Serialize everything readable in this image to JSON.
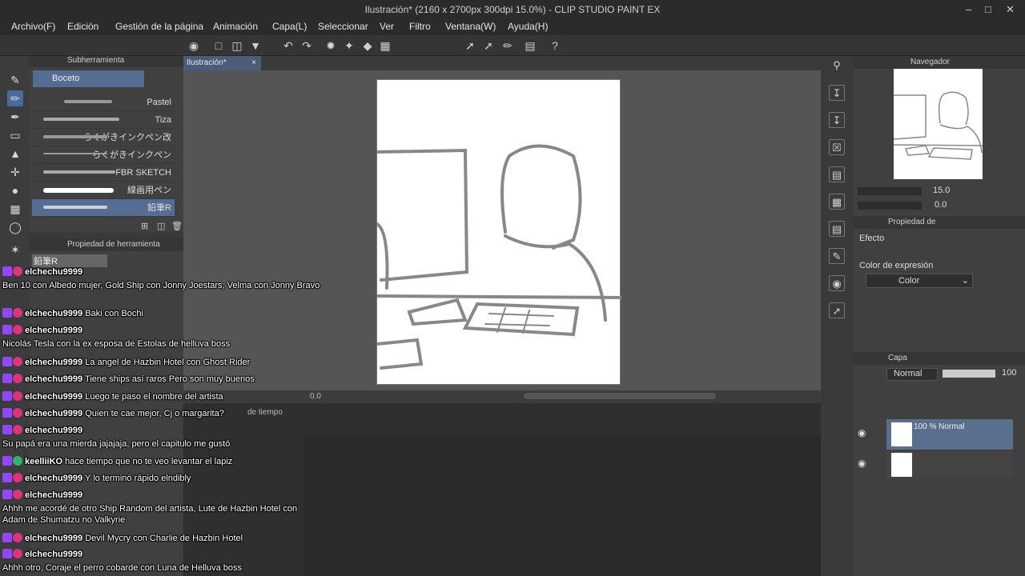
{
  "window": {
    "title": "Ilustración* (2160 x 2700px 300dpi 15.0%) - CLIP STUDIO PAINT EX"
  },
  "menu": [
    "Archivo(F)",
    "Edición",
    "Gestión de la página",
    "Animación",
    "Capa(L)",
    "Seleccionar",
    "Ver",
    "Filtro",
    "Ventana(W)",
    "Ayuda(H)"
  ],
  "doc_tab": {
    "label": "Ilustración*"
  },
  "sub_tool": {
    "header": "Subherramienta",
    "group": "Boceto",
    "brushes": [
      "Pastel",
      "Tiza",
      "らくがきインクペン改",
      "らくがきインクペン",
      "FBR SKETCH",
      "線画用ペン",
      "鉛筆R"
    ],
    "selected_index": 6
  },
  "tool_property": {
    "header": "Propiedad de herramienta",
    "name": "鉛筆R"
  },
  "navigator": {
    "header": "Navegador",
    "zoom": "15.0",
    "angle": "0.0"
  },
  "layer_property": {
    "header": "Propiedad de",
    "effect": "Efecto",
    "expr_label": "Color de expresión",
    "expr_value": "Color"
  },
  "layers": {
    "header": "Capa",
    "blend": "Normal",
    "opacity": "100",
    "layer1": "100 % Normal"
  },
  "status": {
    "zoom": "0.0",
    "timeline": "de tiempo"
  },
  "chat": [
    {
      "user": "elchechu9999",
      "msg": ""
    },
    {
      "user": "",
      "msg": "Ben 10 con Albedo mujer, Gold Ship con Jonny Joestars, Velma con Jonny Bravo"
    },
    {
      "user": "elchechu9999",
      "msg": "Baki con Bochi"
    },
    {
      "user": "elchechu9999",
      "msg": ""
    },
    {
      "user": "",
      "msg": "Nicolás Tesla con la ex esposa de Estolas de helluva boss"
    },
    {
      "user": "elchechu9999",
      "msg": "La angel de Hazbin Hotel con Ghost Rider"
    },
    {
      "user": "elchechu9999",
      "msg": "Tiene ships así raros Pero son muy buenos"
    },
    {
      "user": "elchechu9999",
      "msg": "Luego te paso el nombre del artista"
    },
    {
      "user": "elchechu9999",
      "msg": "Quien te cae mejor, Cj o margarita?"
    },
    {
      "user": "elchechu9999",
      "msg": ""
    },
    {
      "user": "",
      "msg": "Su papá era una mierda jajajaja, pero el capitulo me gustó"
    },
    {
      "user": "keelliiKO",
      "msg": "hace tiempo que no te veo levantar el lapiz"
    },
    {
      "user": "elchechu9999",
      "msg": "Y lo terminó rápido elndibly"
    },
    {
      "user": "elchechu9999",
      "msg": ""
    },
    {
      "user": "",
      "msg": "Ahhh me acordé de otro Ship Random del artista, Lute de Hazbin Hotel con"
    },
    {
      "user": "",
      "msg": "Adam de Shumatzu no Valkyrie"
    },
    {
      "user": "elchechu9999",
      "msg": "Devil Mycry con Charlie de Hazbin Hotel"
    },
    {
      "user": "elchechu9999",
      "msg": ""
    },
    {
      "user": "",
      "msg": "Ahhh otro, Coraje el perro cobarde con Luna de Helluva boss"
    }
  ]
}
